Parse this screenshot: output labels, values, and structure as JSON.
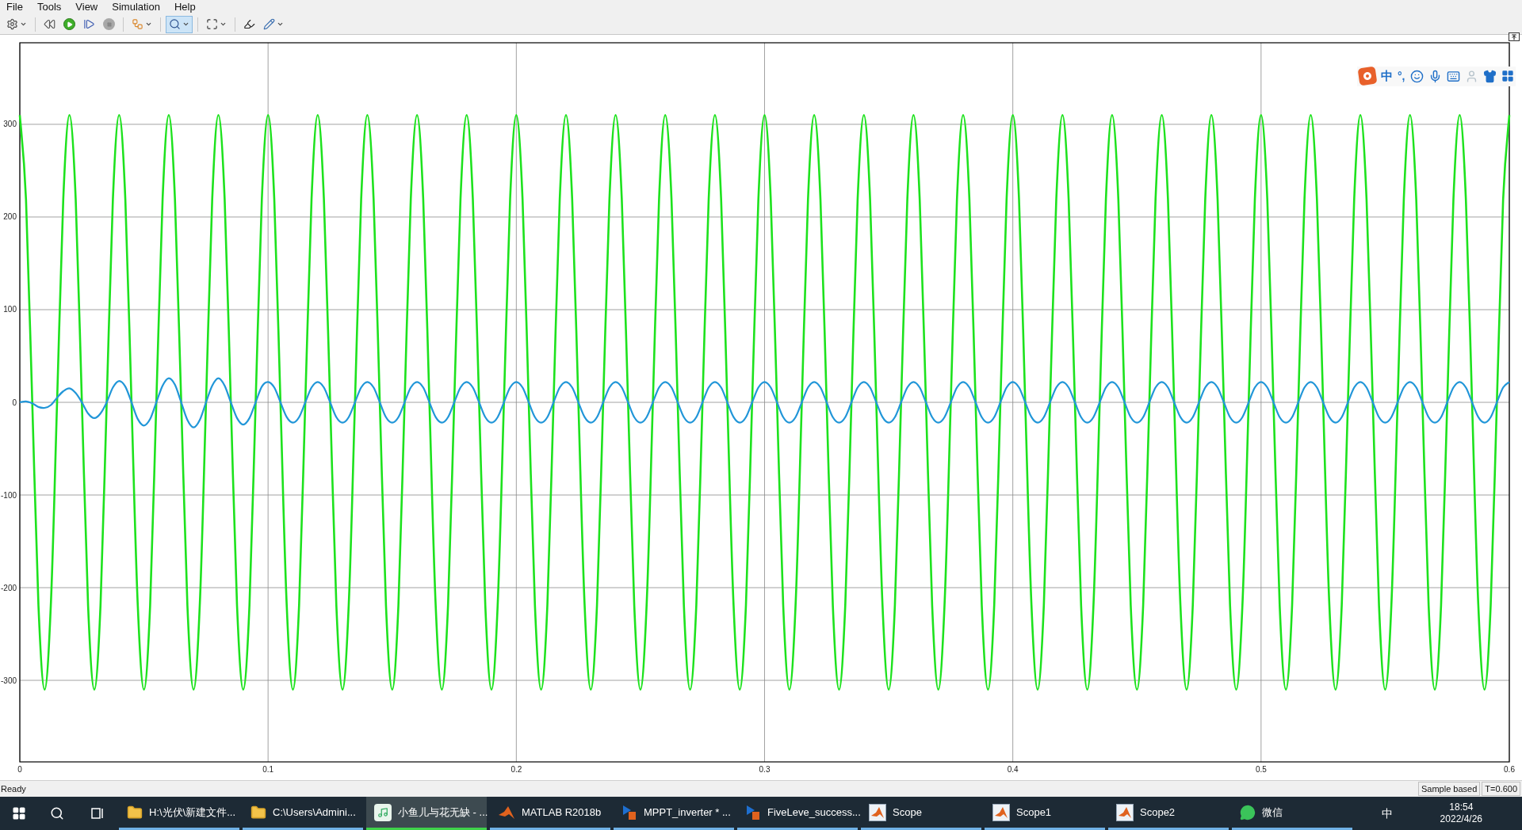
{
  "menu": [
    "File",
    "Tools",
    "View",
    "Simulation",
    "Help"
  ],
  "toolbar": [
    {
      "kind": "settings",
      "dropdown": true,
      "selected": false
    },
    {
      "kind": "step-back",
      "dropdown": false,
      "selected": false
    },
    {
      "kind": "run",
      "dropdown": false,
      "selected": false
    },
    {
      "kind": "step-forward",
      "dropdown": false,
      "selected": false
    },
    {
      "kind": "stop",
      "dropdown": false,
      "selected": false
    },
    {
      "kind": "blocks",
      "dropdown": true,
      "selected": false
    },
    {
      "kind": "zoom",
      "dropdown": true,
      "selected": true
    },
    {
      "kind": "fit",
      "dropdown": true,
      "selected": false
    },
    {
      "kind": "highlight",
      "dropdown": false,
      "selected": false
    },
    {
      "kind": "style",
      "dropdown": true,
      "selected": false
    }
  ],
  "ime_toolbar": {
    "mode": "中",
    "punctuation": "°,"
  },
  "chart_data": {
    "type": "line",
    "grid": true,
    "xlim": [
      0,
      0.6
    ],
    "ylim": [
      -388,
      388
    ],
    "xticks": [
      {
        "value": 0,
        "label": "0"
      },
      {
        "value": 0.1,
        "label": "0.1"
      },
      {
        "value": 0.2,
        "label": "0.2"
      },
      {
        "value": 0.3,
        "label": "0.3"
      },
      {
        "value": 0.4,
        "label": "0.4"
      },
      {
        "value": 0.5,
        "label": "0.5"
      },
      {
        "value": 0.6,
        "label": "0.6"
      }
    ],
    "yticks": [
      -300,
      -200,
      -100,
      0,
      100,
      200,
      300
    ],
    "x": [
      0,
      0.0025,
      0.005,
      0.0075,
      0.01,
      0.0125,
      0.015,
      0.0175,
      0.02,
      0.0225,
      0.025,
      0.0275,
      0.03,
      0.0325,
      0.035,
      0.0375,
      0.04,
      0.0425,
      0.045,
      0.0475,
      0.05,
      0.0525,
      0.055,
      0.0575,
      0.06,
      0.0625,
      0.065,
      0.0675,
      0.07,
      0.0725,
      0.075,
      0.0775,
      0.08,
      0.0825,
      0.085,
      0.0875,
      0.09,
      0.0925,
      0.095,
      0.0975,
      0.1,
      0.1025,
      0.105,
      0.1075,
      0.11,
      0.1125,
      0.115,
      0.1175,
      0.12,
      0.1225,
      0.125,
      0.1275,
      0.13,
      0.1325,
      0.135,
      0.1375,
      0.14,
      0.1425,
      0.145,
      0.1475,
      0.15,
      0.1525,
      0.155,
      0.1575,
      0.16,
      0.1625,
      0.165,
      0.1675,
      0.17,
      0.1725,
      0.175,
      0.1775,
      0.18,
      0.1825,
      0.185,
      0.1875,
      0.19,
      0.1925,
      0.195,
      0.1975,
      0.2,
      0.2025,
      0.205,
      0.2075,
      0.21,
      0.2125,
      0.215,
      0.2175,
      0.22,
      0.2225,
      0.225,
      0.2275,
      0.23,
      0.2325,
      0.235,
      0.2375,
      0.24,
      0.2425,
      0.245,
      0.2475,
      0.25,
      0.2525,
      0.255,
      0.2575,
      0.26,
      0.2625,
      0.265,
      0.2675,
      0.27,
      0.2725,
      0.275,
      0.2775,
      0.28,
      0.2825,
      0.285,
      0.2875,
      0.29,
      0.2925,
      0.295,
      0.2975,
      0.3,
      0.3025,
      0.305,
      0.3075,
      0.31,
      0.3125,
      0.315,
      0.3175,
      0.32,
      0.3225,
      0.325,
      0.3275,
      0.33,
      0.3325,
      0.335,
      0.3375,
      0.34,
      0.3425,
      0.345,
      0.3475,
      0.35,
      0.3525,
      0.355,
      0.3575,
      0.36,
      0.3625,
      0.365,
      0.3675,
      0.37,
      0.3725,
      0.375,
      0.3775,
      0.38,
      0.3825,
      0.385,
      0.3875,
      0.39,
      0.3925,
      0.395,
      0.3975,
      0.4,
      0.4025,
      0.405,
      0.4075,
      0.41,
      0.4125,
      0.415,
      0.4175,
      0.42,
      0.4225,
      0.425,
      0.4275,
      0.43,
      0.4325,
      0.435,
      0.4375,
      0.44,
      0.4425,
      0.445,
      0.4475,
      0.45,
      0.4525,
      0.455,
      0.4575,
      0.46,
      0.4625,
      0.465,
      0.4675,
      0.47,
      0.4725,
      0.475,
      0.4775,
      0.48,
      0.4825,
      0.485,
      0.4875,
      0.49,
      0.4925,
      0.495,
      0.4975,
      0.5,
      0.5025,
      0.505,
      0.5075,
      0.51,
      0.5125,
      0.515,
      0.5175,
      0.52,
      0.5225,
      0.525,
      0.5275,
      0.53,
      0.5325,
      0.535,
      0.5375,
      0.54,
      0.5425,
      0.545,
      0.5475,
      0.55,
      0.5525,
      0.555,
      0.5575,
      0.56,
      0.5625,
      0.565,
      0.5675,
      0.57,
      0.5725,
      0.575,
      0.5775,
      0.58,
      0.5825,
      0.585,
      0.5875,
      0.59,
      0.5925,
      0.595,
      0.5975,
      0.6
    ],
    "series": [
      {
        "color": "#1de21d",
        "values": [
          310,
          219,
          0,
          -219,
          -310,
          -219,
          0,
          219,
          310,
          219,
          0,
          -219,
          -310,
          -219,
          0,
          219,
          310,
          219,
          0,
          -219,
          -310,
          -219,
          0,
          219,
          310,
          219,
          0,
          -219,
          -310,
          -219,
          0,
          219,
          310,
          219,
          0,
          -219,
          -310,
          -219,
          0,
          219,
          310,
          219,
          0,
          -219,
          -310,
          -219,
          0,
          219,
          310,
          219,
          0,
          -219,
          -310,
          -219,
          0,
          219,
          310,
          219,
          0,
          -219,
          -310,
          -219,
          0,
          219,
          310,
          219,
          0,
          -219,
          -310,
          -219,
          0,
          219,
          310,
          219,
          0,
          -219,
          -310,
          -219,
          0,
          219,
          310,
          219,
          0,
          -219,
          -310,
          -219,
          0,
          219,
          310,
          219,
          0,
          -219,
          -310,
          -219,
          0,
          219,
          310,
          219,
          0,
          -219,
          -310,
          -219,
          0,
          219,
          310,
          219,
          0,
          -219,
          -310,
          -219,
          0,
          219,
          310,
          219,
          0,
          -219,
          -310,
          -219,
          0,
          219,
          310,
          219,
          0,
          -219,
          -310,
          -219,
          0,
          219,
          310,
          219,
          0,
          -219,
          -310,
          -219,
          0,
          219,
          310,
          219,
          0,
          -219,
          -310,
          -219,
          0,
          219,
          310,
          219,
          0,
          -219,
          -310,
          -219,
          0,
          219,
          310,
          219,
          0,
          -219,
          -310,
          -219,
          0,
          219,
          310,
          219,
          0,
          -219,
          -310,
          -219,
          0,
          219,
          310,
          219,
          0,
          -219,
          -310,
          -219,
          0,
          219,
          310,
          219,
          0,
          -219,
          -310,
          -219,
          0,
          219,
          310,
          219,
          0,
          -219,
          -310,
          -219,
          0,
          219,
          310,
          219,
          0,
          -219,
          -310,
          -219,
          0,
          219,
          310,
          219,
          0,
          -219,
          -310,
          -219,
          0,
          219,
          310,
          219,
          0,
          -219,
          -310,
          -219,
          0,
          219,
          310,
          219,
          0,
          -219,
          -310,
          -219,
          0,
          219,
          310,
          219,
          0,
          -219,
          -310,
          -219,
          0,
          219,
          310,
          219,
          0,
          -219,
          -310,
          -219,
          0,
          219,
          310
        ]
      },
      {
        "color": "#2196d8",
        "values": [
          0,
          1,
          -1,
          -5,
          -6,
          -3,
          5,
          12,
          15,
          10,
          0,
          -12,
          -17,
          -12,
          0,
          16,
          23,
          17,
          0,
          -18,
          -25,
          -18,
          0,
          18,
          26,
          19,
          0,
          -19,
          -27,
          -19,
          0,
          18,
          26,
          18,
          0,
          -17,
          -24,
          -17,
          0,
          17,
          22,
          16,
          0,
          -16,
          -22,
          -16,
          0,
          16,
          22,
          16,
          0,
          -16,
          -22,
          -16,
          0,
          16,
          22,
          16,
          0,
          -16,
          -22,
          -16,
          0,
          16,
          22,
          16,
          0,
          -16,
          -22,
          -16,
          0,
          16,
          22,
          16,
          0,
          -16,
          -22,
          -16,
          0,
          16,
          22,
          16,
          0,
          -16,
          -22,
          -16,
          0,
          16,
          22,
          16,
          0,
          -16,
          -22,
          -16,
          0,
          16,
          22,
          16,
          0,
          -16,
          -22,
          -16,
          0,
          16,
          22,
          16,
          0,
          -16,
          -22,
          -16,
          0,
          16,
          22,
          16,
          0,
          -16,
          -22,
          -16,
          0,
          16,
          22,
          16,
          0,
          -16,
          -22,
          -16,
          0,
          16,
          22,
          16,
          0,
          -16,
          -22,
          -16,
          0,
          16,
          22,
          16,
          0,
          -16,
          -22,
          -16,
          0,
          16,
          22,
          16,
          0,
          -16,
          -22,
          -16,
          0,
          16,
          22,
          16,
          0,
          -16,
          -22,
          -16,
          0,
          16,
          22,
          16,
          0,
          -16,
          -22,
          -16,
          0,
          16,
          22,
          16,
          0,
          -16,
          -22,
          -16,
          0,
          16,
          22,
          16,
          0,
          -16,
          -22,
          -16,
          0,
          16,
          22,
          16,
          0,
          -16,
          -22,
          -16,
          0,
          16,
          22,
          16,
          0,
          -16,
          -22,
          -16,
          0,
          16,
          22,
          16,
          0,
          -16,
          -22,
          -16,
          0,
          16,
          22,
          16,
          0,
          -16,
          -22,
          -16,
          0,
          16,
          22,
          16,
          0,
          -16,
          -22,
          -16,
          0,
          16,
          22,
          16,
          0,
          -16,
          -22,
          -16,
          0,
          16,
          22,
          16,
          0,
          -16,
          -22,
          -16,
          0,
          16,
          22
        ]
      }
    ]
  },
  "status_bar": {
    "message": "Ready",
    "mode": "Sample based",
    "time": "T=0.600"
  },
  "taskbar": {
    "items": [
      {
        "kind": "folder",
        "label": "H:\\光伏\\新建文件...",
        "selected": false
      },
      {
        "kind": "folder",
        "label": "C:\\Users\\Admini...",
        "selected": false
      },
      {
        "kind": "music",
        "label": "小鱼儿与花无缺 - ...",
        "selected": true
      },
      {
        "kind": "matlab",
        "label": "MATLAB R2018b",
        "selected": false
      },
      {
        "kind": "simulink",
        "label": "MPPT_inverter * ...",
        "selected": false
      },
      {
        "kind": "simulink",
        "label": "FiveLeve_success...",
        "selected": false
      },
      {
        "kind": "scope",
        "label": "Scope",
        "selected": false
      },
      {
        "kind": "scope",
        "label": "Scope1",
        "selected": false
      },
      {
        "kind": "scope",
        "label": "Scope2",
        "selected": false
      },
      {
        "kind": "wechat",
        "label": "微信",
        "selected": false
      }
    ],
    "ime": "中",
    "time": "18:54",
    "date": "2022/4/26"
  }
}
